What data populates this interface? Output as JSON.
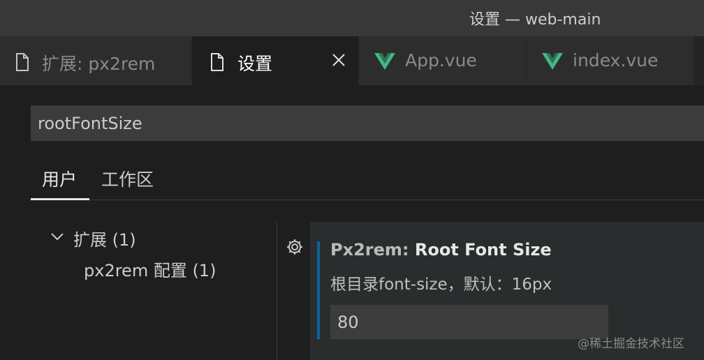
{
  "window": {
    "title": "设置 — web-main"
  },
  "tabs": [
    {
      "label": "扩展: px2rem",
      "icon": "file-icon",
      "active": false
    },
    {
      "label": "设置",
      "icon": "file-icon",
      "active": true
    },
    {
      "label": "App.vue",
      "icon": "vue-icon",
      "active": false
    },
    {
      "label": "index.vue",
      "icon": "vue-icon",
      "active": false
    }
  ],
  "search": {
    "value": "rootFontSize"
  },
  "scopes": {
    "user": "用户",
    "workspace": "工作区"
  },
  "toc": {
    "group_label": "扩展 (1)",
    "item_label": "px2rem 配置 (1)"
  },
  "setting": {
    "category": "Px2rem: ",
    "name": "Root Font Size",
    "description": "根目录font-size，默认：16px",
    "value": "80"
  },
  "watermark": "@稀土掘金技术社区",
  "colors": {
    "background": "#1e1e1e",
    "titlebar": "#383838",
    "accent": "#0e639c",
    "vue_green": "#41b883"
  }
}
